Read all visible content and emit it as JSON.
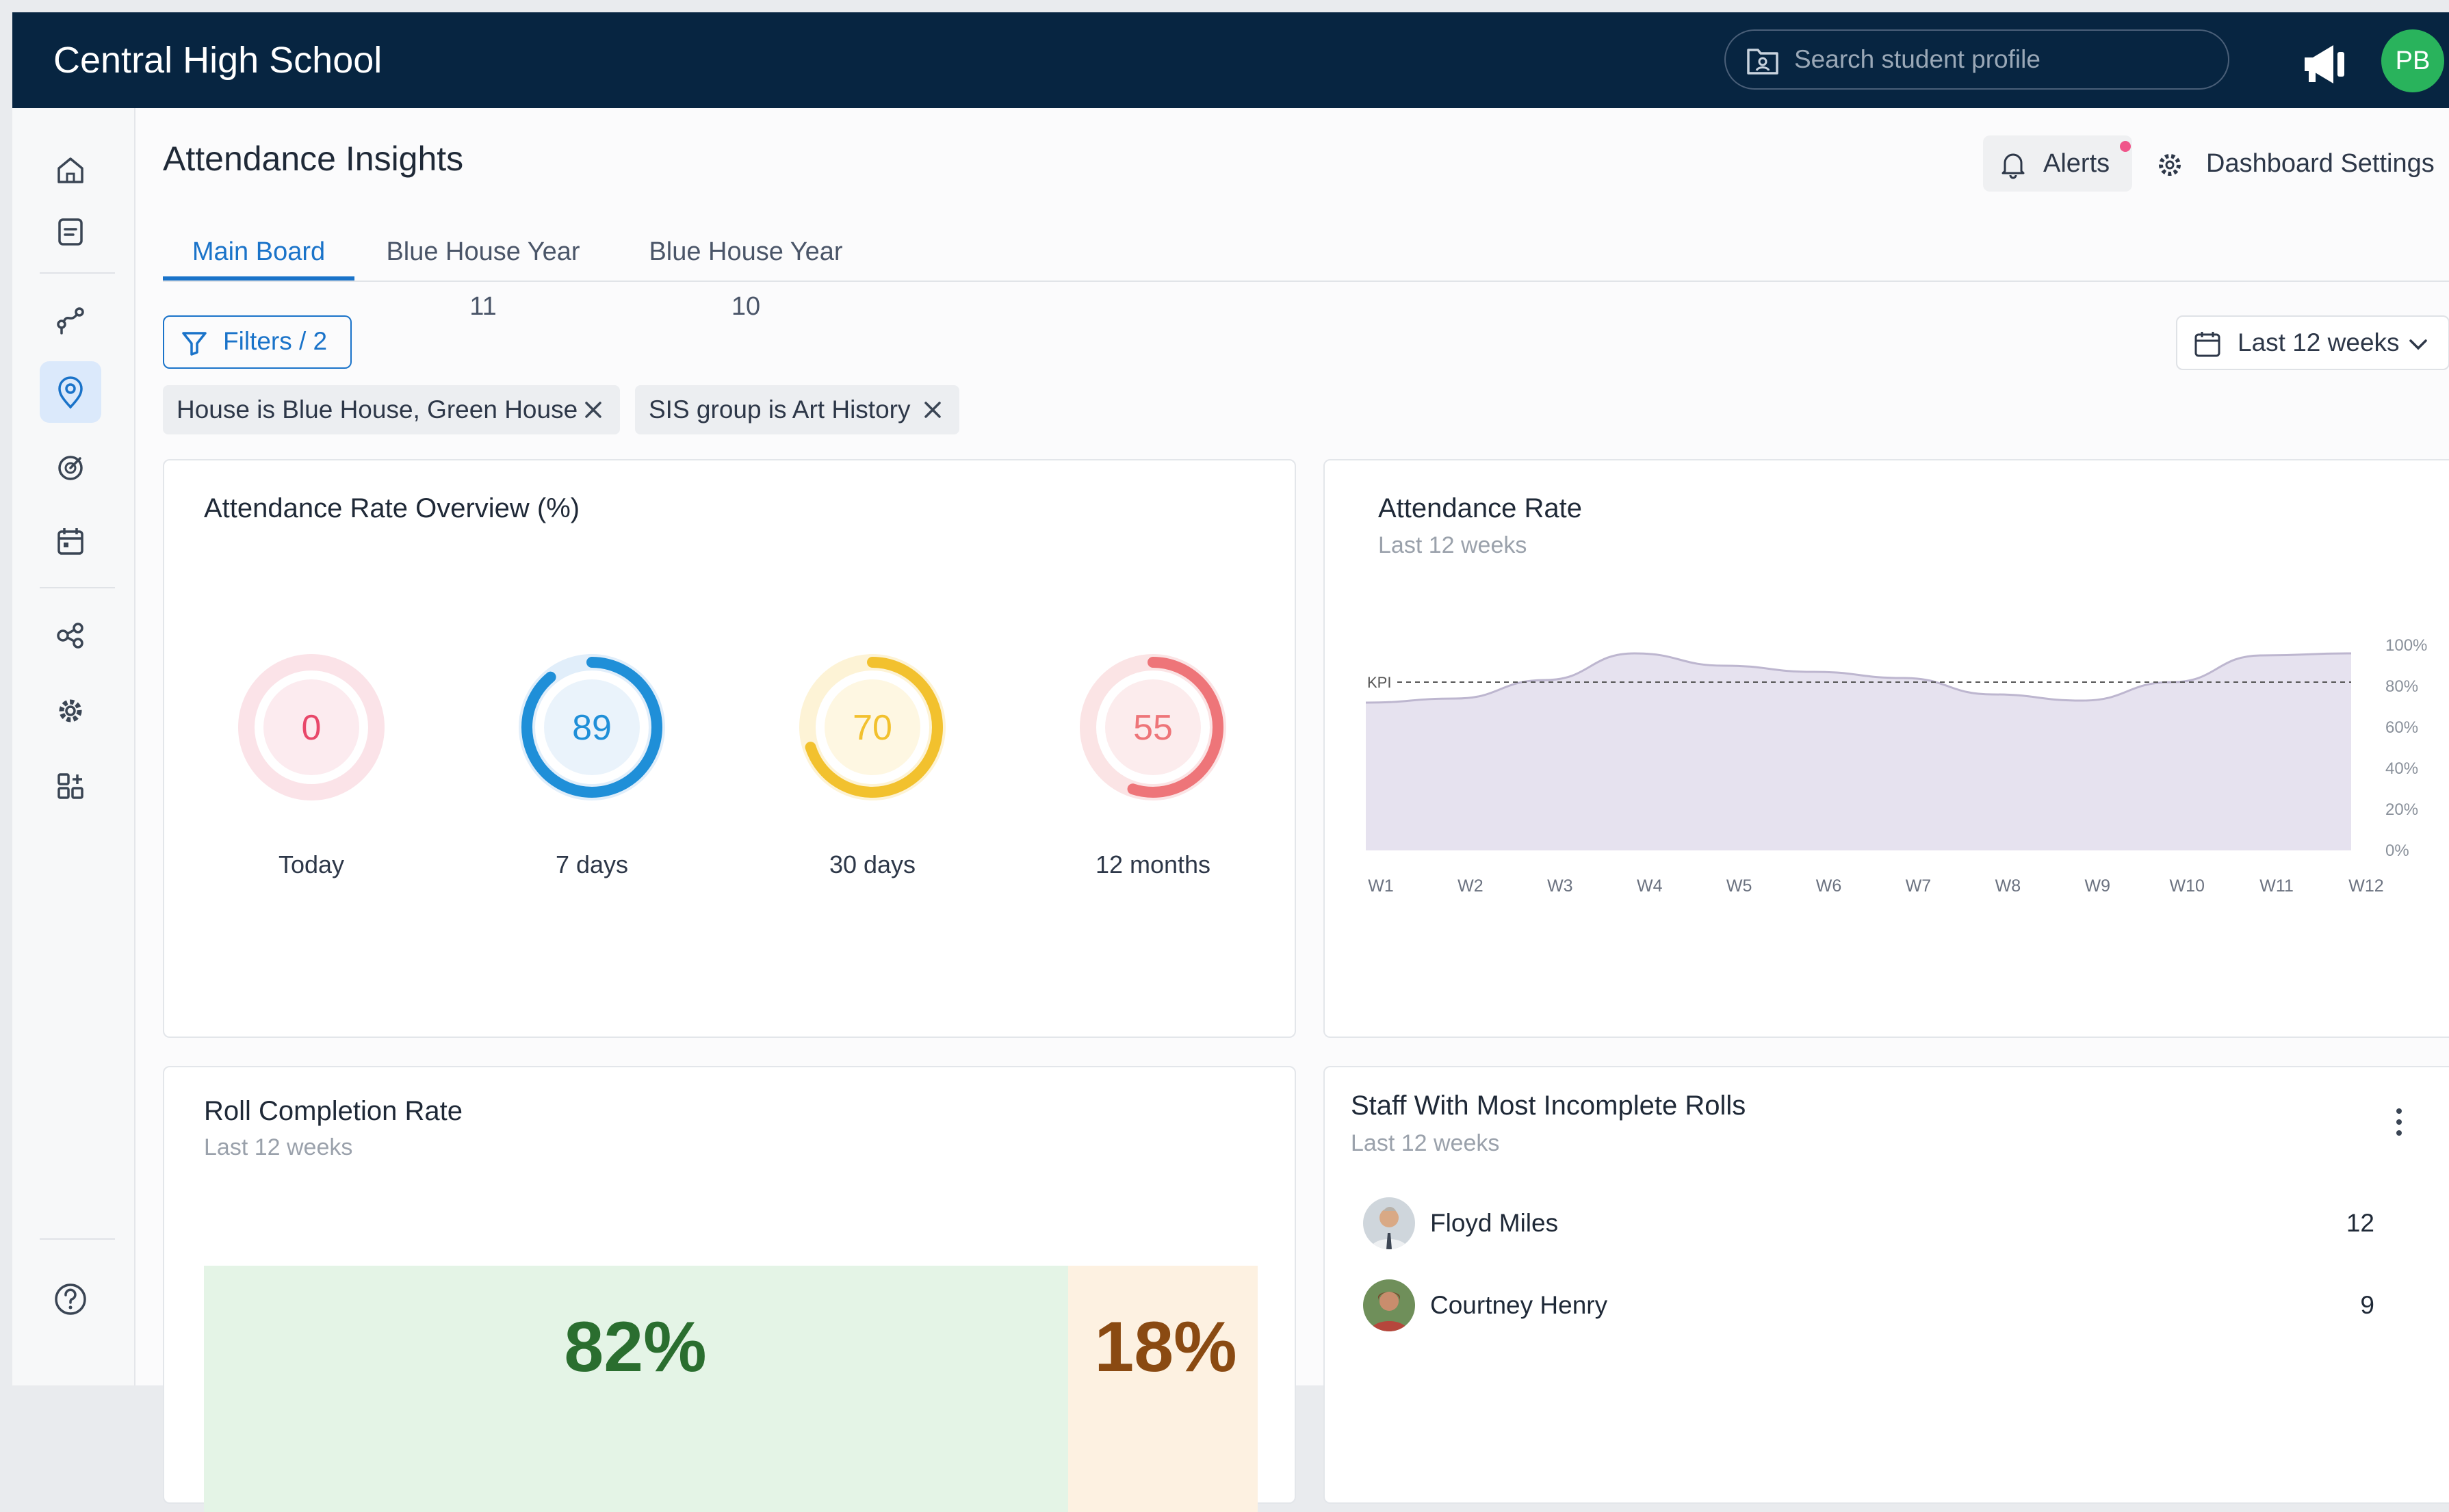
{
  "header": {
    "school_name": "Central High School",
    "search_placeholder": "Search student profile",
    "avatar_initials": "PB",
    "brand_color": "#072541"
  },
  "sidebar": {
    "items": [
      {
        "icon": "home-icon"
      },
      {
        "icon": "document-icon"
      },
      {
        "icon": "route-icon"
      },
      {
        "icon": "location-pin-icon",
        "active": true
      },
      {
        "icon": "radar-icon"
      },
      {
        "icon": "calendar-icon"
      },
      {
        "icon": "share-nodes-icon"
      },
      {
        "icon": "gear-icon"
      },
      {
        "icon": "grid-add-icon"
      },
      {
        "icon": "help-icon"
      }
    ]
  },
  "page": {
    "title": "Attendance Insights",
    "alerts_label": "Alerts",
    "settings_label": "Dashboard Settings"
  },
  "tabs": [
    {
      "label": "Main Board",
      "active": true
    },
    {
      "label": "Blue House Year 11"
    },
    {
      "label": "Blue House Year 10"
    }
  ],
  "filters": {
    "button_label": "Filters / 2",
    "date_range": "Last 12 weeks",
    "chips": [
      "House is Blue House, Green House",
      "SIS group is Art History"
    ]
  },
  "overview": {
    "title": "Attendance Rate Overview (%)",
    "gauges": [
      {
        "value": "0",
        "label": "Today",
        "fraction": 0.0,
        "color": "#e8486a",
        "ring": "#fbe3e8"
      },
      {
        "value": "89",
        "label": "7 days",
        "fraction": 0.89,
        "color": "#1f8fd8",
        "ring": "#e1eefa"
      },
      {
        "value": "70",
        "label": "30 days",
        "fraction": 0.7,
        "color": "#f2c12e",
        "ring": "#fdf3d6"
      },
      {
        "value": "55",
        "label": "12 months",
        "fraction": 0.55,
        "color": "#ee7579",
        "ring": "#fbe4e5"
      }
    ]
  },
  "rate_card": {
    "title": "Attendance Rate",
    "subtitle": "Last 12 weeks"
  },
  "chart_data": {
    "type": "area",
    "title": "Attendance Rate",
    "subtitle": "Last 12 weeks",
    "categories": [
      "W1",
      "W2",
      "W3",
      "W4",
      "W5",
      "W6",
      "W7",
      "W8",
      "W9",
      "W10",
      "W11",
      "W12"
    ],
    "values": [
      72,
      74,
      83,
      96,
      90,
      87,
      84,
      76,
      73,
      82,
      95,
      96
    ],
    "kpi": 82,
    "kpi_label": "KPI",
    "y_ticks": [
      "0%",
      "20%",
      "40%",
      "60%",
      "80%",
      "100%"
    ],
    "ylim": [
      0,
      100
    ],
    "fill_color": "#e6e2ef",
    "line_color": "#bdb6cf",
    "grid": false
  },
  "roll_card": {
    "title": "Roll Completion Rate",
    "subtitle": "Last 12 weeks",
    "complete_pct": "82%",
    "incomplete_pct": "18%",
    "complete_fraction": 0.82
  },
  "staff_card": {
    "title": "Staff With Most Incomplete Rolls",
    "subtitle": "Last 12 weeks",
    "rows": [
      {
        "name": "Floyd Miles",
        "count": "12"
      },
      {
        "name": "Courtney Henry",
        "count": "9"
      }
    ]
  }
}
